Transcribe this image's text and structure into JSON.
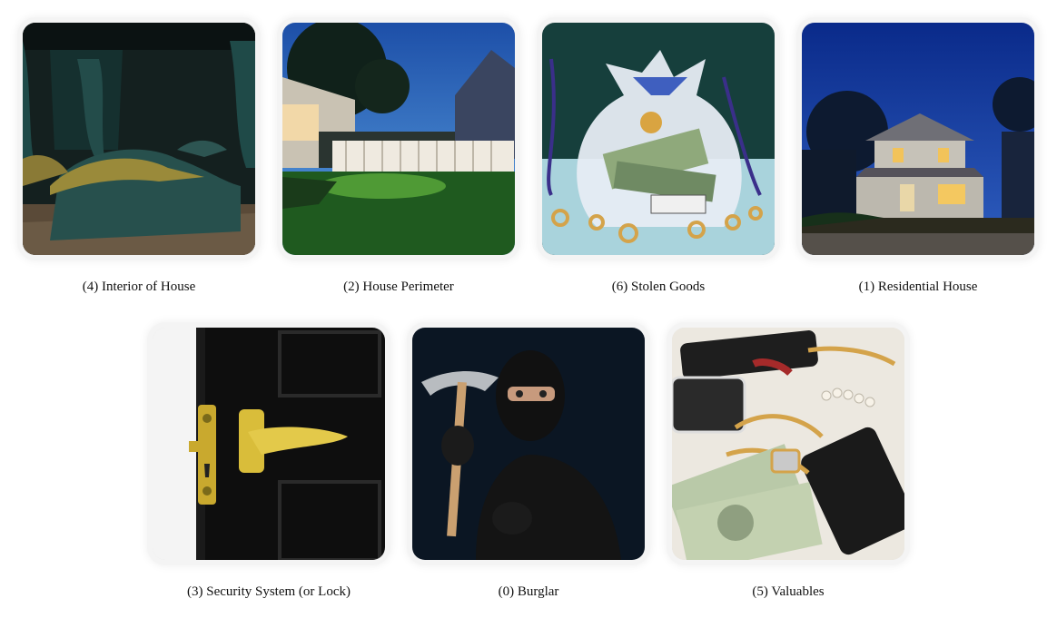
{
  "cards": [
    {
      "label": "(4) Interior of House"
    },
    {
      "label": "(2) House Perimeter"
    },
    {
      "label": "(6) Stolen Goods"
    },
    {
      "label": "(1) Residential House"
    },
    {
      "label": "(3) Security System (or Lock)"
    },
    {
      "label": "(0) Burglar"
    },
    {
      "label": "(5) Valuables"
    }
  ]
}
